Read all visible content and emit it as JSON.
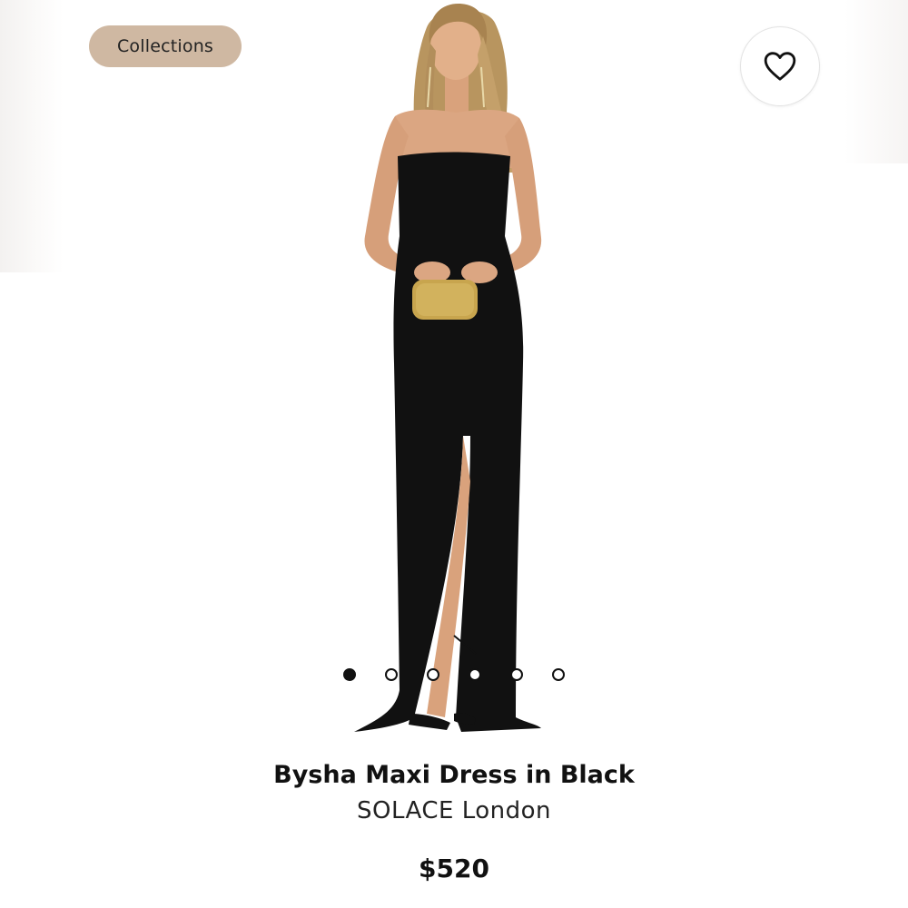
{
  "header": {
    "collections_label": "Collections",
    "favorite_icon": "heart-outline-icon"
  },
  "gallery": {
    "image_count": 6,
    "active_index": 0
  },
  "product": {
    "title": "Bysha Maxi Dress in Black",
    "brand": "SOLACE London",
    "price": "$520"
  },
  "colors": {
    "pill_background": "#cfb8a2",
    "dot_color": "#111111"
  }
}
